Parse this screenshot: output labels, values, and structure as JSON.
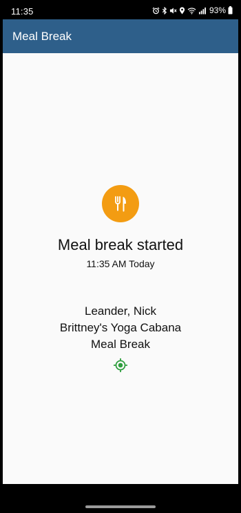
{
  "status_bar": {
    "time": "11:35",
    "battery": "93%",
    "icons": [
      "alarm-icon",
      "bluetooth-icon",
      "mute-icon",
      "location-icon",
      "wifi-icon",
      "signal-icon",
      "battery-icon"
    ]
  },
  "app_bar": {
    "title": "Meal Break"
  },
  "main": {
    "icon": "fork-knife-icon",
    "icon_color": "#f39c12",
    "status_title": "Meal break started",
    "status_time": "11:35 AM Today",
    "employee_name": "Leander, Nick",
    "location_name": "Brittney's Yoga Cabana",
    "break_type": "Meal Break",
    "location_indicator_icon": "gps-target-icon",
    "location_indicator_color": "#2e9e3e"
  },
  "colors": {
    "app_bar": "#2e5f8a",
    "background": "#fafafa"
  }
}
